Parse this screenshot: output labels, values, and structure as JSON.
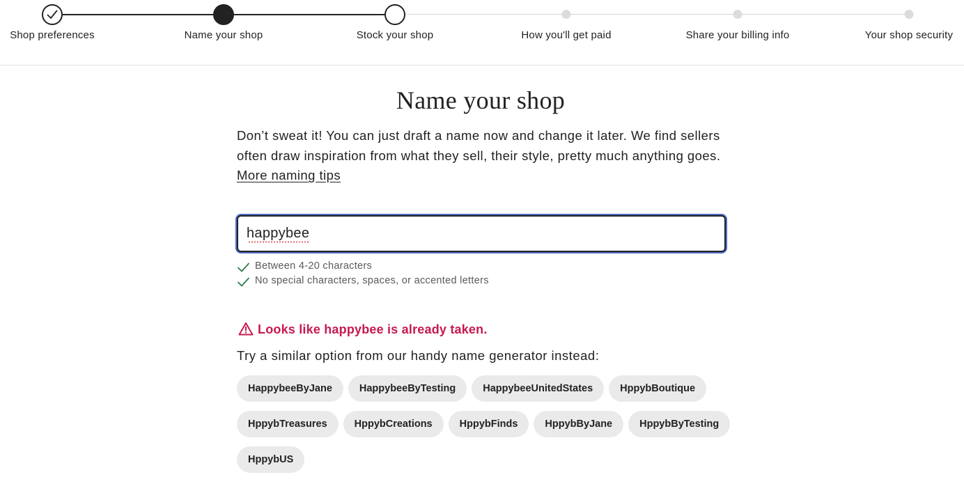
{
  "stepper": {
    "steps": [
      {
        "label": "Shop preferences",
        "state": "completed"
      },
      {
        "label": "Name your shop",
        "state": "current"
      },
      {
        "label": "Stock your shop",
        "state": "next"
      },
      {
        "label": "How you'll get paid",
        "state": "upcoming"
      },
      {
        "label": "Share your billing info",
        "state": "upcoming"
      },
      {
        "label": "Your shop security",
        "state": "upcoming"
      }
    ]
  },
  "main": {
    "title": "Name your shop",
    "description": "Don’t sweat it! You can just draft a name now and change it later. We find sellers often draw inspiration from what they sell, their style, pretty much anything goes.",
    "tips_link": "More naming tips",
    "shop_name_input": {
      "value": "happybee"
    },
    "rules": [
      {
        "text": "Between 4-20 characters",
        "icon": "check-icon",
        "met": true
      },
      {
        "text": "No special characters, spaces, or accented letters",
        "icon": "check-icon",
        "met": true
      }
    ],
    "error": {
      "icon": "warning-triangle-icon",
      "text": "Looks like happybee is already taken.",
      "color": "#c7194f"
    },
    "suggestion_intro": "Try a similar option from our handy name generator instead:",
    "suggestions": [
      "HappybeeByJane",
      "HappybeeByTesting",
      "HappybeeUnitedStates",
      "HppybBoutique",
      "HppybTreasures",
      "HppybCreations",
      "HppybFinds",
      "HppybByJane",
      "HppybByTesting",
      "HppybUS"
    ]
  },
  "colors": {
    "focus_ring": "#4d6bc6",
    "check": "#2e7d4f",
    "error": "#c7194f",
    "chip_bg": "#eaeaea"
  }
}
